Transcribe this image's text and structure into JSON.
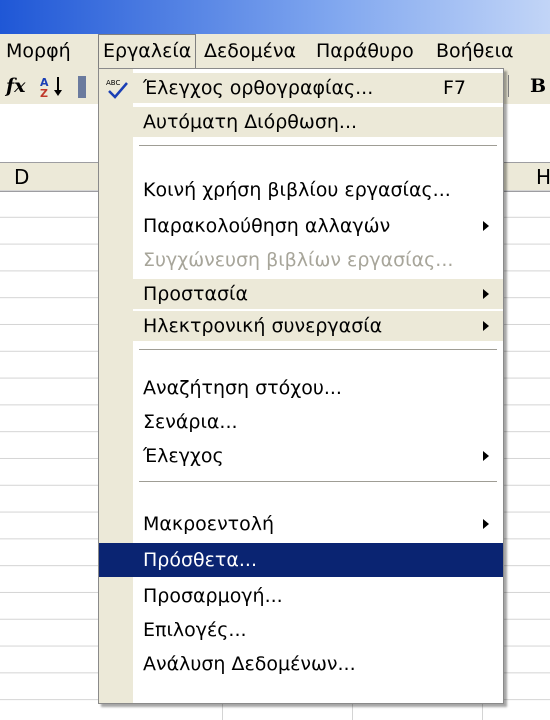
{
  "menubar": {
    "items": [
      {
        "label": "Μορφή",
        "active": false
      },
      {
        "label": "Εργαλεία",
        "active": true
      },
      {
        "label": "Δεδομένα",
        "active": false
      },
      {
        "label": "Παράθυρο",
        "active": false
      },
      {
        "label": "Βοήθεια",
        "active": false
      }
    ]
  },
  "toolbar": {
    "fx": "fx",
    "sort_icon": "sort-ascending-icon",
    "bold_label": "B"
  },
  "columns": {
    "left": "D",
    "right": "H"
  },
  "menu": {
    "spelling": {
      "label": "Έλεγχος ορθογραφίας...",
      "shortcut": "F7",
      "icon": "spell-check-icon"
    },
    "autocorrect": {
      "label": "Αυτόματη Διόρθωση..."
    },
    "share_workbook": {
      "label": "Κοινή χρήση βιβλίου εργασίας..."
    },
    "track_changes": {
      "label": "Παρακολούθηση αλλαγών"
    },
    "merge_workbooks": {
      "label": "Συγχώνευση βιβλίων εργασίας..."
    },
    "protection": {
      "label": "Προστασία"
    },
    "online_collaboration": {
      "label": "Ηλεκτρονική συνεργασία"
    },
    "goal_seek": {
      "label": "Αναζήτηση στόχου..."
    },
    "scenarios": {
      "label": "Σενάρια..."
    },
    "auditing": {
      "label": "Έλεγχος"
    },
    "macro": {
      "label": "Μακροεντολή"
    },
    "addins": {
      "label": "Πρόσθετα..."
    },
    "customize": {
      "label": "Προσαρμογή..."
    },
    "options": {
      "label": "Επιλογές..."
    },
    "data_analysis": {
      "label": "Ανάλυση Δεδομένων..."
    }
  },
  "colors": {
    "menu_highlight": "#0a2472",
    "menu_band": "#ece9d8",
    "titlebar": "#1f57d6"
  }
}
